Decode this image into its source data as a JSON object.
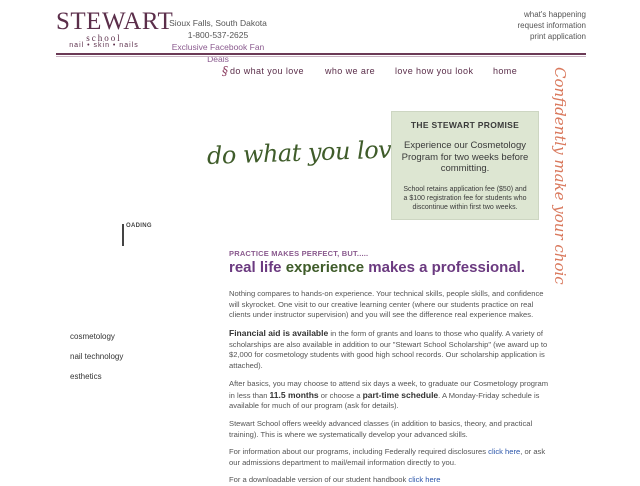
{
  "brand": {
    "name": "STEWART",
    "school": "school",
    "subtitle": "nail • skin • nails"
  },
  "contact": {
    "location": "Sioux Falls, South Dakota",
    "phone": "1-800-537-2625",
    "facebook_link": "Exclusive Facebook Fan Deals"
  },
  "top_links": [
    "what's happening",
    "request information",
    "print application"
  ],
  "nav": {
    "mark": "§",
    "items": [
      "do what you love",
      "who we are",
      "love how you look",
      "home"
    ]
  },
  "headline_script": "do what you love",
  "side_script": "Confidently make your choice.",
  "promise": {
    "title": "THE STEWART PROMISE",
    "main": "Experience our Cosmetology Program for two weeks before committing.",
    "small": "School retains application fee ($50) and a $100 registration fee for students who discontinue within first two weeks."
  },
  "loading_text": "OADING",
  "sidebar": [
    "cosmetology",
    "nail technology",
    "esthetics"
  ],
  "content": {
    "kicker": "PRACTICE MAKES PERFECT, BUT.....",
    "tagline_1": "real life ",
    "tagline_2": "experience",
    "tagline_3": " makes a professional.",
    "p1": "Nothing compares to hands-on experience. Your technical skills, people skills, and confidence will skyrocket. One visit to our creative learning center (where our students practice on real clients under instructor supervision) and you will see the difference real experience makes.",
    "p2_bold": "Financial aid is available",
    "p2_rest": " in the form of grants and loans to those who qualify. A variety of scholarships are also available in addition to our \"Stewart School Scholarship\" (we award up to $2,000 for cosmetology students with good high school records. Our scholarship application is attached).",
    "p3_a": "After basics, you may choose to attend six days a week, to graduate our Cosmetology program in less than ",
    "p3_b1": "11.5 months",
    "p3_c": " or choose a ",
    "p3_b2": "part-time schedule",
    "p3_d": ". A Monday-Friday schedule is available for much of our program (ask for details).",
    "p4": "Stewart School offers weekly advanced classes (in addition to basics, theory, and practical training). This is where we systematically develop your advanced skills.",
    "p5_a": "For information about our programs, including Federally required disclosures ",
    "p5_link": "click here",
    "p5_b": ", or ask our admissions department to mail/email information directly to you.",
    "p6_a": "For a downloadable version of our student handbook ",
    "p6_link": "click here"
  },
  "colors": {
    "plum": "#5b2e4a",
    "purple": "#6b3a80",
    "green": "#3f5c2a",
    "promise_bg": "#dde6d2",
    "side_script": "#d9785c"
  }
}
